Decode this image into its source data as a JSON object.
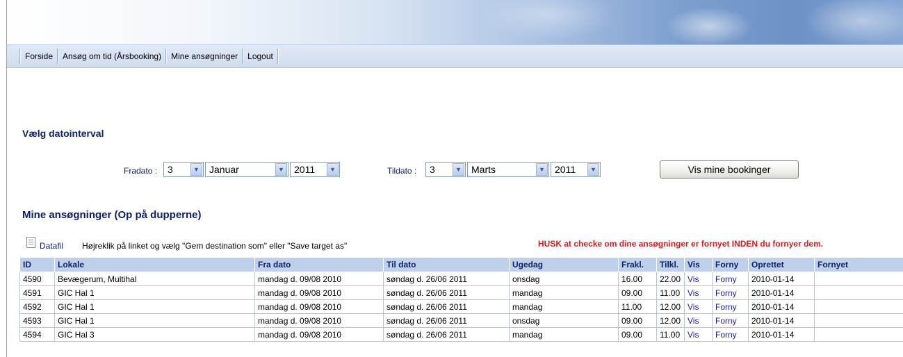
{
  "nav": {
    "items": [
      "Forside",
      "Ansøg om tid (Årsbooking)",
      "Mine ansøgninger",
      "Logout"
    ]
  },
  "filter": {
    "heading": "Vælg datointerval",
    "from_label": "Fradato :",
    "to_label": "Tildato :",
    "from_day": "3",
    "from_month": "Januar",
    "from_year": "2011",
    "to_day": "3",
    "to_month": "Marts",
    "to_year": "2011",
    "submit_label": "Vis mine bookinger"
  },
  "applications": {
    "heading": "Mine ansøgninger (Op på dupperne)",
    "datafil_label": "Datafil",
    "hint": "Højreklik på linket og vælg \"Gem destination som\" eller \"Save target as\"",
    "warning": "HUSK at checke om dine ansøgninger er fornyet INDEN du fornyer dem.",
    "columns": [
      "ID",
      "Lokale",
      "Fra dato",
      "Til dato",
      "Ugedag",
      "Frakl.",
      "Tilkl.",
      "Vis",
      "Forny",
      "Oprettet",
      "Fornyet"
    ],
    "rows": [
      [
        "4590",
        "Bevægerum, Multihal",
        "mandag d. 09/08 2010",
        "søndag d. 26/06 2011",
        "onsdag",
        "16.00",
        "22.00",
        "Vis",
        "Forny",
        "2010-01-14",
        ""
      ],
      [
        "4591",
        "GIC Hal 1",
        "mandag d. 09/08 2010",
        "søndag d. 26/06 2011",
        "mandag",
        "09.00",
        "11.00",
        "Vis",
        "Forny",
        "2010-01-14",
        ""
      ],
      [
        "4592",
        "GIC Hal 1",
        "mandag d. 09/08 2010",
        "søndag d. 26/06 2011",
        "mandag",
        "11.00",
        "12.00",
        "Vis",
        "Forny",
        "2010-01-14",
        ""
      ],
      [
        "4593",
        "GIC Hal 1",
        "mandag d. 09/08 2010",
        "søndag d. 26/06 2011",
        "onsdag",
        "09.00",
        "12.00",
        "Vis",
        "Forny",
        "2010-01-14",
        ""
      ],
      [
        "4594",
        "GIC Hal 3",
        "mandag d. 09/08 2010",
        "søndag d. 26/06 2011",
        "mandag",
        "09.00",
        "11.00",
        "Vis",
        "Forny",
        "2010-01-14",
        ""
      ]
    ]
  }
}
